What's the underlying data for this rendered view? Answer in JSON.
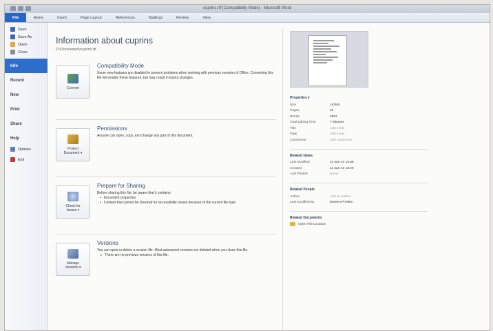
{
  "window": {
    "title": "cuprins.rtf [Compatibility Mode] - Microsoft Word"
  },
  "ribbon": {
    "tabs": [
      "File",
      "Home",
      "Insert",
      "Page Layout",
      "References",
      "Mailings",
      "Review",
      "View"
    ]
  },
  "nav": {
    "commands": [
      {
        "label": "Save",
        "icon": "save-icon",
        "color": "#3a66b5"
      },
      {
        "label": "Save As",
        "icon": "save-as-icon",
        "color": "#3a66b5"
      },
      {
        "label": "Open",
        "icon": "open-folder-icon",
        "color": "#e0a93a"
      },
      {
        "label": "Close",
        "icon": "close-doc-icon",
        "color": "#8c8c8c"
      }
    ],
    "tabs": [
      "Info",
      "Recent",
      "New",
      "Print",
      "Share",
      "Help"
    ],
    "footer": [
      {
        "label": "Options",
        "icon": "options-icon",
        "color": "#5b7fb8"
      },
      {
        "label": "Exit",
        "icon": "exit-icon",
        "color": "#c23a2e"
      }
    ],
    "active": "Info"
  },
  "info": {
    "title": "Information about cuprins",
    "path": "D:\\Docs\\word\\cuprins.rtf",
    "compat": {
      "button": "Convert",
      "title": "Compatibility Mode",
      "desc": "Some new features are disabled to prevent problems when working with previous versions of Office. Converting this file will enable these features, but may result in layout changes."
    },
    "permissions": {
      "button_line1": "Protect",
      "button_line2": "Document ▾",
      "title": "Permissions",
      "desc": "Anyone can open, copy, and change any part of this document."
    },
    "sharing": {
      "button_line1": "Check for",
      "button_line2": "Issues ▾",
      "title": "Prepare for Sharing",
      "desc": "Before sharing this file, be aware that it contains:",
      "bullets": [
        "Document properties",
        "Content that cannot be checked for accessibility issues because of the current file type"
      ]
    },
    "versions": {
      "button_line1": "Manage",
      "button_line2": "Versions ▾",
      "title": "Versions",
      "desc": "You can open or delete a version file. Most autosaved versions are deleted when you close this file.",
      "note": "There are no previous versions of this file."
    }
  },
  "properties": {
    "heading": "Properties ▾",
    "rows": [
      {
        "k": "Size",
        "v": "197KB",
        "muted": false
      },
      {
        "k": "Pages",
        "v": "40",
        "muted": false
      },
      {
        "k": "Words",
        "v": "2561",
        "muted": false
      },
      {
        "k": "Total Editing Time",
        "v": "7 Minutes",
        "muted": false
      },
      {
        "k": "Title",
        "v": "Add a title",
        "muted": true
      },
      {
        "k": "Tags",
        "v": "Add a tag",
        "muted": true
      },
      {
        "k": "Comments",
        "v": "Add comments",
        "muted": true
      }
    ],
    "dates_heading": "Related Dates",
    "dates": [
      {
        "k": "Last Modified",
        "v": "11-Jan-10 13:35",
        "muted": false
      },
      {
        "k": "Created",
        "v": "11-Jan-10 13:29",
        "muted": false
      },
      {
        "k": "Last Printed",
        "v": "Never",
        "muted": true
      }
    ],
    "people_heading": "Related People",
    "people": [
      {
        "k": "Author",
        "v": "Add an author",
        "muted": true
      },
      {
        "k": "Last Modified By",
        "v": "Doreen Preslen",
        "muted": false
      }
    ],
    "docs_heading": "Related Documents",
    "open_location": "Open File Location"
  }
}
